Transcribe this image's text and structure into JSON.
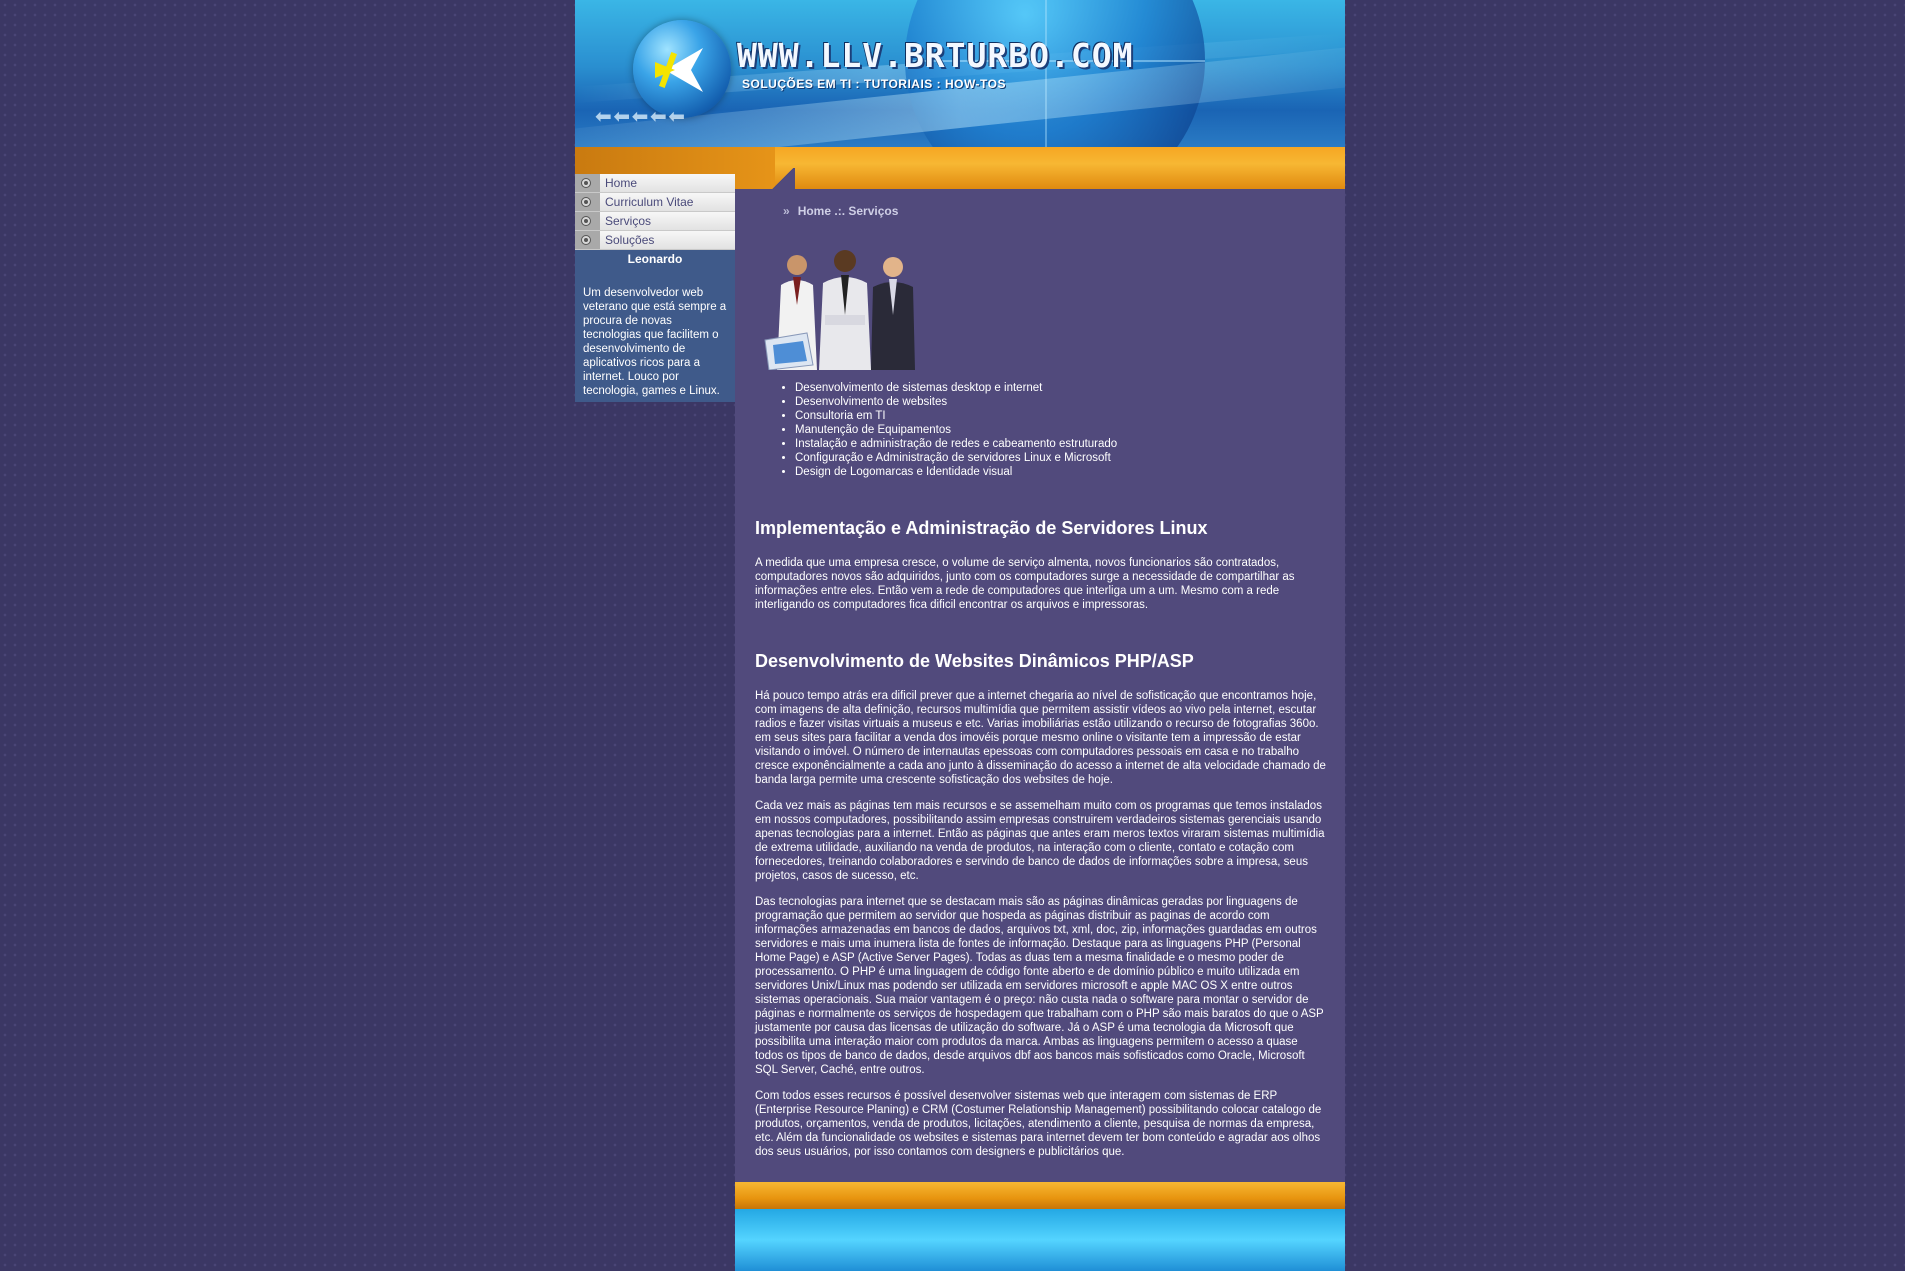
{
  "header": {
    "site_title": "WWW.LLV.BRTURBO.COM",
    "subtitle": "SOLUÇÕES EM TI : TUTORIAIS : HOW-TOS"
  },
  "nav": {
    "items": [
      {
        "label": "Home"
      },
      {
        "label": "Curriculum Vitae"
      },
      {
        "label": "Serviços"
      },
      {
        "label": "Soluções"
      }
    ]
  },
  "profile": {
    "name": "Leonardo",
    "bio": "Um desenvolvedor web veterano que está sempre a procura de novas tecnologias que facilitem o desenvolvimento de aplicativos ricos para a internet. Louco por tecnologia, games e Linux."
  },
  "breadcrumb": "Home .:. Serviços",
  "services": [
    "Desenvolvimento de sistemas desktop e internet",
    "Desenvolvimento de websites",
    "Consultoria em TI",
    "Manutenção de Equipamentos",
    "Instalação e administração de redes e cabeamento estruturado",
    "Configuração e Administração de servidores Linux e Microsoft",
    "Design de Logomarcas e Identidade visual"
  ],
  "sections": [
    {
      "heading": "Implementação e Administração de Servidores Linux",
      "paragraphs": [
        "A medida que uma empresa cresce, o volume de serviço almenta, novos funcionarios são contratados, computadores novos são adquiridos, junto com os computadores surge a necessidade de compartilhar as informações entre eles. Então vem a rede de computadores que interliga um a um. Mesmo com a rede interligando os computadores fica dificil encontrar os arquivos e impressoras."
      ]
    },
    {
      "heading": "Desenvolvimento de Websites Dinâmicos PHP/ASP",
      "paragraphs": [
        "Há pouco tempo atrás era dificil prever que a internet chegaria ao nível de sofisticação que encontramos hoje, com imagens de alta definição, recursos multimídia que permitem assistir vídeos ao vivo pela internet, escutar radios e fazer visitas virtuais a museus e etc. Varias imobiliárias estão utilizando o recurso de fotografias 360o. em seus sites para facilitar a venda dos imovéis porque mesmo online o visitante tem a impressão de estar visitando o imóvel. O número de internautas epessoas com computadores pessoais em casa e no trabalho cresce exponêncialmente a cada ano junto à disseminação do acesso a internet de alta velocidade chamado de banda larga permite uma crescente sofisticação dos websites de hoje.",
        "Cada vez mais as páginas tem mais recursos e se assemelham muito com os programas que temos instalados em nossos computadores, possibilitando assim empresas construirem verdadeiros sistemas gerenciais usando apenas tecnologias para a internet. Então as páginas que antes eram meros textos viraram sistemas multimídia de extrema utilidade, auxiliando na venda de produtos, na interação com o cliente, contato e cotação com fornecedores, treinando colaboradores e servindo de banco de dados de informações sobre a impresa, seus projetos, casos de sucesso, etc.",
        "Das tecnologias para internet que se destacam mais são as páginas dinâmicas geradas por linguagens de programação que permitem ao servidor que hospeda as páginas distribuir as paginas de acordo com informações armazenadas em bancos de dados, arquivos txt, xml, doc, zip, informações guardadas em outros servidores e mais uma inumera lista de fontes de informação. Destaque para as linguagens PHP (Personal Home Page) e ASP (Active Server Pages). Todas as duas tem a mesma finalidade e o mesmo poder de processamento. O PHP é uma linguagem de código fonte aberto e de domínio público e muito utilizada em servidores Unix/Linux mas podendo ser utilizada em servidores microsoft e apple MAC OS X entre outros sistemas operacionais. Sua maior vantagem é o preço: não custa nada o software para montar o servidor de páginas e normalmente os serviços de hospedagem que trabalham com o PHP são mais baratos do que o ASP justamente por causa das licensas de utilização do software. Já o ASP é uma tecnologia da Microsoft que possibilita uma interação maior com produtos da marca. Ambas as linguagens permitem o acesso a quase todos os tipos de banco de dados, desde arquivos dbf aos bancos mais sofisticados como Oracle, Microsoft SQL Server, Caché, entre outros.",
        "Com todos esses recursos é possível desenvolver sistemas web que interagem com sistemas de ERP (Enterprise Resource Planing) e CRM (Costumer Relationship Management) possibilitando colocar catalogo de produtos, orçamentos, venda de produtos, licitações, atendimento a cliente, pesquisa de normas da empresa, etc. Além da funcionalidade os websites e sistemas para internet devem ter bom conteúdo e agradar aos olhos dos seus usuários, por isso contamos com designers e publicitários que."
      ]
    }
  ]
}
